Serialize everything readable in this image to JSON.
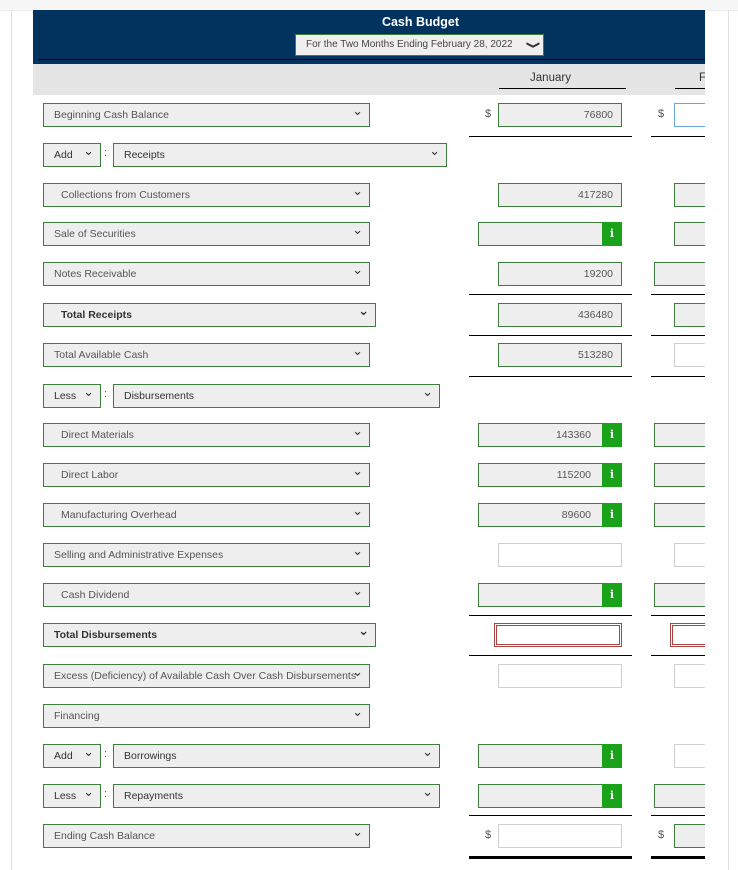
{
  "header": {
    "title": "Cash Budget",
    "period_select": "For the Two Months Ending February 28, 2022",
    "columns": [
      "January",
      "February"
    ],
    "columns_visible": [
      "January",
      "F"
    ],
    "brand_color": "#02335f"
  },
  "chevron": "❯",
  "currency_symbol": "$",
  "info_glyph": "i",
  "rows": {
    "beginning_cash": {
      "label": "Beginning Cash Balance",
      "jan": "76800",
      "feb": ""
    },
    "receipts_header": {
      "op": "Add",
      "label": "Receipts"
    },
    "collections": {
      "label": "Collections from Customers",
      "jan": "417280",
      "feb": ""
    },
    "sale_of_securities": {
      "label": "Sale of Securities",
      "jan": "",
      "feb": ""
    },
    "notes_receivable": {
      "label": "Notes Receivable",
      "jan": "19200",
      "feb": ""
    },
    "total_receipts": {
      "label": "Total Receipts",
      "jan": "436480",
      "feb": ""
    },
    "total_available_cash": {
      "label": "Total Available Cash",
      "jan": "513280",
      "feb": ""
    },
    "disbursements_header": {
      "op": "Less",
      "label": "Disbursements"
    },
    "direct_materials": {
      "label": "Direct Materials",
      "jan": "143360",
      "feb": ""
    },
    "direct_labor": {
      "label": "Direct Labor",
      "jan": "115200",
      "feb": ""
    },
    "manufacturing_overhead": {
      "label": "Manufacturing Overhead",
      "jan": "89600",
      "feb": ""
    },
    "selling_admin": {
      "label": "Selling and Administrative Expenses",
      "jan": "",
      "feb": ""
    },
    "cash_dividend": {
      "label": "Cash Dividend",
      "jan": "",
      "feb": ""
    },
    "total_disbursements": {
      "label": "Total Disbursements",
      "jan": "",
      "feb": ""
    },
    "excess_deficiency": {
      "label": "Excess (Deficiency) of Available Cash Over Cash Disbursements",
      "jan": "",
      "feb": ""
    },
    "financing": {
      "label": "Financing"
    },
    "borrowings": {
      "op": "Add",
      "label": "Borrowings",
      "jan": "",
      "feb": ""
    },
    "repayments": {
      "op": "Less",
      "label": "Repayments",
      "jan": "",
      "feb": ""
    },
    "ending_cash": {
      "label": "Ending Cash Balance",
      "jan": "",
      "feb": ""
    }
  }
}
